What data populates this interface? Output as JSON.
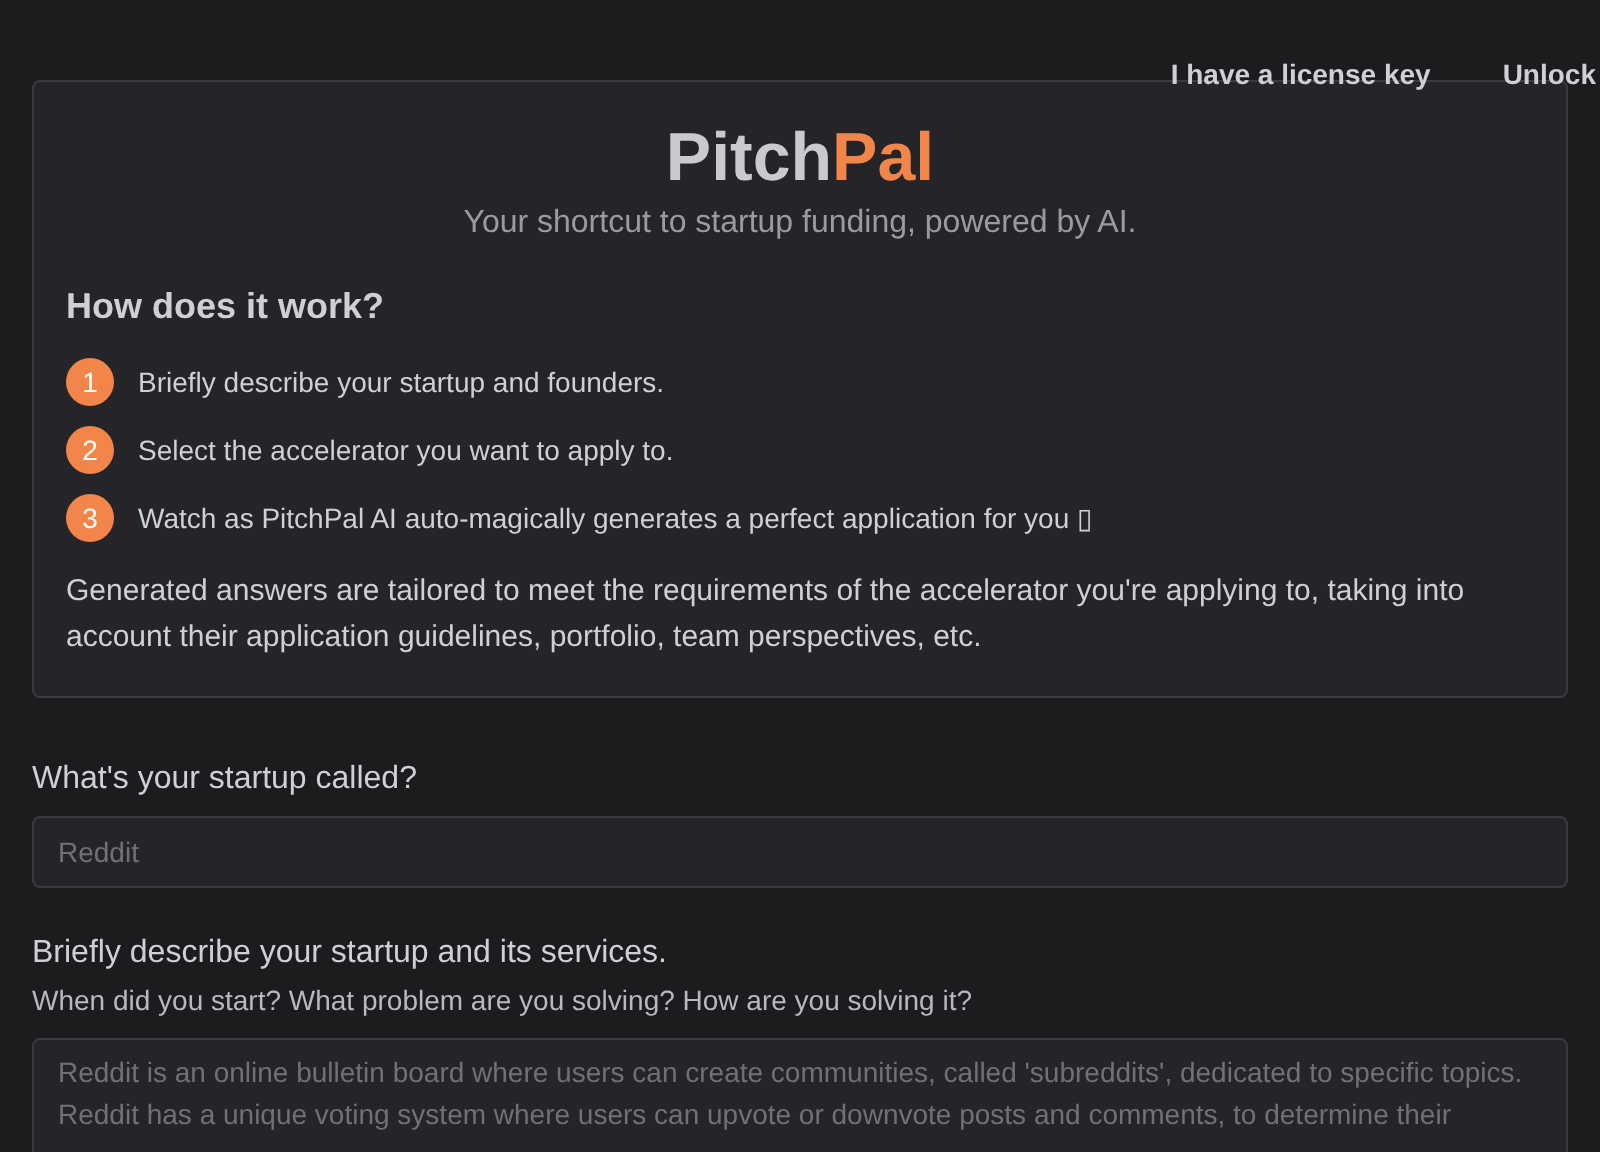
{
  "header": {
    "links": [
      "I have a license key",
      "Unlock"
    ]
  },
  "intro": {
    "title_parts": [
      "Pitch",
      "Pal"
    ],
    "subtitle": "Your shortcut to startup funding, powered by AI.",
    "heading": "How does it work?",
    "steps": [
      {
        "number": "1",
        "text": "Briefly describe your startup and founders."
      },
      {
        "number": "2",
        "text": "Select the accelerator you want to apply to."
      },
      {
        "number": "3",
        "text": "Watch as PitchPal AI auto-magically generates a perfect application for you ▯"
      }
    ],
    "note": "Generated answers are tailored to meet the requirements of the accelerator you're applying to, taking into account their application guidelines, portfolio, team perspectives, etc."
  },
  "form": [
    {
      "kind": "input",
      "label": "What's your startup called?",
      "placeholder": "Reddit"
    },
    {
      "kind": "textarea",
      "label": "Briefly describe your startup and its services.",
      "hint": "When did you start? What problem are you solving? How are you solving it?",
      "placeholder": "Reddit is an online bulletin board where users can create communities, called 'subreddits', dedicated to specific topics. Reddit has a unique voting system where users can upvote or downvote posts and comments, to determine their"
    }
  ]
}
